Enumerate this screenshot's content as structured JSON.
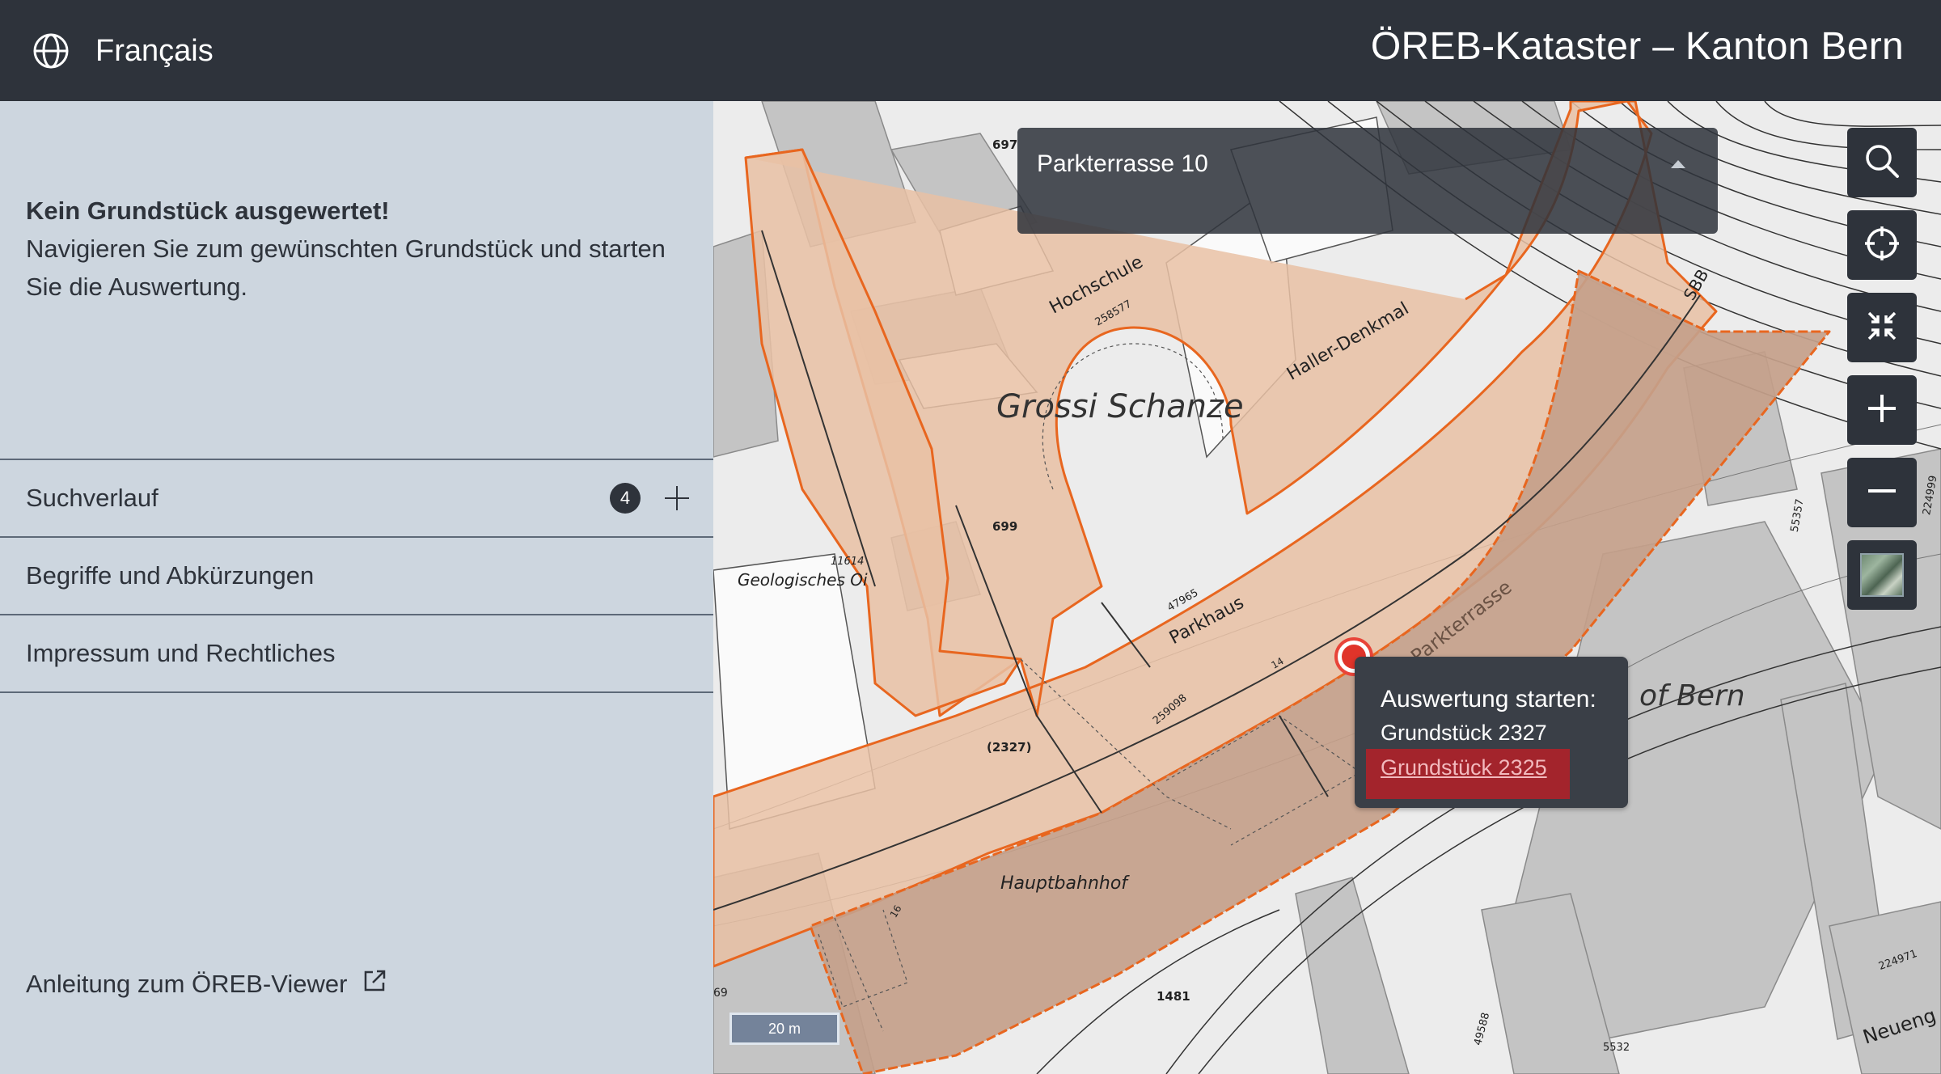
{
  "header": {
    "language_label": "Français",
    "title": "ÖREB-Kataster – Kanton Bern"
  },
  "sidebar": {
    "info_title": "Kein Grundstück ausgewertet!",
    "info_text": "Navigieren Sie zum gewünschten Grundstück und starten Sie die Auswertung.",
    "accordion": [
      {
        "label": "Suchverlauf",
        "badge": "4"
      },
      {
        "label": "Begriffe und Abkürzungen"
      },
      {
        "label": "Impressum und Rechtliches"
      }
    ],
    "manual_link": "Anleitung zum ÖREB-Viewer"
  },
  "search": {
    "value": "Parkterrasse 10"
  },
  "map_controls": [
    {
      "icon": "search-icon"
    },
    {
      "icon": "locate-icon"
    },
    {
      "icon": "collapse-icon"
    },
    {
      "icon": "zoom-in-icon"
    },
    {
      "icon": "zoom-out-icon"
    },
    {
      "icon": "layer-switch-icon"
    }
  ],
  "popup": {
    "title": "Auswertung starten:",
    "parcel": "Grundstück 2327",
    "link": "Grundstück 2325"
  },
  "map_labels": {
    "grossi_schanze": "Grossi Schanze",
    "hochschule": "Hochschule",
    "haller_denkmal": "Haller-Denkmal",
    "parkhaus": "Parkhaus",
    "parkterrasse": "Parkterrasse",
    "hauptbahnhof": "Hauptbahnhof",
    "of_bern": "of Bern",
    "sbb": "SBB",
    "geologisches": "Geologisches Oi",
    "neueng": "Neueng",
    "n697": "697",
    "n699": "699",
    "n2327": "(2327)",
    "n1481": "1481",
    "n47965": "47965",
    "n259098": "259098",
    "n258577": "258577",
    "n11614": "11614",
    "n5532": "5532",
    "n14": "14",
    "n16": "16",
    "n224971": "224971",
    "n55357": "55357",
    "n4958": "49588",
    "n224999": "224999",
    "n69": "69"
  },
  "scale": "20 m",
  "colors": {
    "header_bg": "#2e333b",
    "sidebar_bg": "#cdd6df",
    "parcel_outline": "#e8661f",
    "parcel_fill": "#e9c1a4",
    "parcel_selected": "#c4a08a",
    "popup_link_bg": "#a3242c"
  }
}
